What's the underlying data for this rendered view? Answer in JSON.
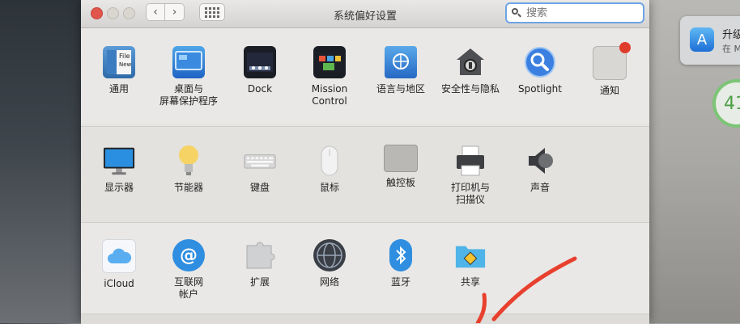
{
  "window": {
    "title": "系统偏好设置",
    "search_placeholder": "搜索"
  },
  "nav": {
    "back": "‹",
    "forward": "›"
  },
  "rows": {
    "personal": [
      {
        "label": "通用",
        "icon": "general-file-icon"
      },
      {
        "label": "桌面与\n屏幕保护程序",
        "icon": "desktop-screensaver-icon"
      },
      {
        "label": "Dock",
        "icon": "dock-icon"
      },
      {
        "label": "Mission\nControl",
        "icon": "mission-control-icon"
      },
      {
        "label": "语言与地区",
        "icon": "language-region-icon"
      },
      {
        "label": "安全性与隐私",
        "icon": "security-privacy-icon"
      },
      {
        "label": "Spotlight",
        "icon": "spotlight-icon"
      },
      {
        "label": "通知",
        "icon": "notifications-icon"
      }
    ],
    "hardware": [
      {
        "label": "显示器",
        "icon": "displays-icon"
      },
      {
        "label": "节能器",
        "icon": "energy-saver-icon"
      },
      {
        "label": "键盘",
        "icon": "keyboard-icon"
      },
      {
        "label": "鼠标",
        "icon": "mouse-icon"
      },
      {
        "label": "触控板",
        "icon": "trackpad-icon"
      },
      {
        "label": "打印机与\n扫描仪",
        "icon": "printers-scanners-icon"
      },
      {
        "label": "声音",
        "icon": "sound-icon"
      }
    ],
    "internet": [
      {
        "label": "iCloud",
        "icon": "icloud-icon"
      },
      {
        "label": "互联网\n帐户",
        "icon": "internet-accounts-icon"
      },
      {
        "label": "扩展",
        "icon": "extensions-icon"
      },
      {
        "label": "网络",
        "icon": "network-icon"
      },
      {
        "label": "蓝牙",
        "icon": "bluetooth-icon"
      },
      {
        "label": "共享",
        "icon": "sharing-icon"
      }
    ]
  },
  "notification": {
    "title": "升级",
    "subtitle": "在 M"
  },
  "badge_text": "41",
  "colors": {
    "accent": "#6fa4e6",
    "close": "#e0564c",
    "annotation": "#e8402e"
  }
}
